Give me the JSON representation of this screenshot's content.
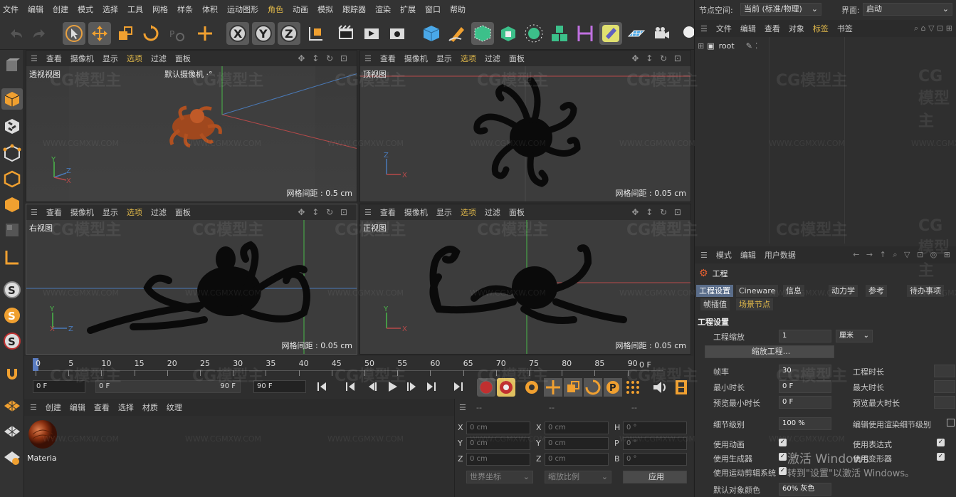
{
  "menubar": {
    "items": [
      "文件",
      "编辑",
      "创建",
      "模式",
      "选择",
      "工具",
      "网格",
      "样条",
      "体积",
      "运动图形",
      "角色",
      "动画",
      "模拟",
      "跟踪器",
      "渲染",
      "扩展",
      "窗口",
      "帮助"
    ]
  },
  "topright": {
    "node_space_label": "节点空间:",
    "node_space_value": "当前 (标准/物理)",
    "interface_label": "界面:",
    "interface_value": "启动"
  },
  "viewport_menu": {
    "items": [
      "查看",
      "摄像机",
      "显示",
      "选项",
      "过滤",
      "面板"
    ],
    "selected": "选项"
  },
  "viewports": {
    "perspective": {
      "name": "透视视图",
      "camera": "默认摄像机 ·°",
      "grid": "网格间距 : 0.5 cm"
    },
    "top": {
      "name": "顶视图",
      "grid": "网格间距 : 0.05 cm"
    },
    "right": {
      "name": "右视图",
      "grid": "网格间距 : 0.05 cm"
    },
    "front": {
      "name": "正视图",
      "grid": "网格间距 : 0.05 cm"
    }
  },
  "axes": {
    "x": "X",
    "y": "Y",
    "z": "Z"
  },
  "timeline": {
    "ticks": [
      "0",
      "5",
      "10",
      "15",
      "20",
      "25",
      "30",
      "35",
      "40",
      "45",
      "50",
      "55",
      "60",
      "65",
      "70",
      "75",
      "80",
      "85",
      "90"
    ],
    "current_frame": "0 F",
    "field_start": "0 F",
    "range_start": "0 F",
    "range_end": "90 F",
    "field_end": "90 F"
  },
  "material_panel": {
    "menu": [
      "创建",
      "编辑",
      "查看",
      "选择",
      "材质",
      "纹理"
    ],
    "material_name": "Materia"
  },
  "coord_panel": {
    "x_pos": "0 cm",
    "y_pos": "0 cm",
    "z_pos": "0 cm",
    "x_size": "0 cm",
    "y_size": "0 cm",
    "z_size": "0 cm",
    "h": "0 °",
    "p": "0 °",
    "b": "0 °",
    "labels": {
      "x": "X",
      "y": "Y",
      "z": "Z",
      "h": "H",
      "p": "P",
      "b": "B"
    },
    "world_coord": "世界坐标",
    "scale_ratio": "缩放比例",
    "apply": "应用",
    "dash1": "--",
    "dash2": "--",
    "dash3": "--"
  },
  "object_manager": {
    "menu": [
      "文件",
      "编辑",
      "查看",
      "对象",
      "标签",
      "书签"
    ],
    "root_label": "root"
  },
  "attribute_manager": {
    "menu": [
      "模式",
      "编辑",
      "用户数据"
    ],
    "title": "工程",
    "tabs_row1": [
      "工程设置",
      "Cineware",
      "信息",
      "动力学",
      "参考",
      "待办事项"
    ],
    "tabs_row2": [
      "帧插值",
      "场景节点"
    ],
    "section": "工程设置",
    "project_scale_label": "工程缩放",
    "project_scale_value": "1",
    "project_scale_unit": "厘米",
    "scale_project_btn": "缩放工程...",
    "fps_label": "帧率",
    "fps_value": "30",
    "project_length_label": "工程时长",
    "min_time_label": "最小时长",
    "min_time_value": "0 F",
    "max_time_label": "最大时长",
    "preview_min_label": "预览最小时长",
    "preview_min_value": "0 F",
    "preview_max_label": "预览最大时长",
    "lod_label": "细节级别",
    "lod_value": "100 %",
    "render_lod_label": "编辑使用渲染细节级别",
    "use_anim_label": "使用动画",
    "use_expr_label": "使用表达式",
    "use_gen_label": "使用生成器",
    "use_deform_label": "使用变形器",
    "use_mograph_label": "使用运动剪辑系统",
    "default_color_label": "默认对象颜色",
    "default_color_value": "60% 灰色"
  },
  "windows_activation": {
    "line1": "激活 Windows",
    "line2": "转到\"设置\"以激活 Windows。"
  },
  "watermark": {
    "logo": "CG模型主",
    "url": "WWW.CGMXW.COM"
  }
}
